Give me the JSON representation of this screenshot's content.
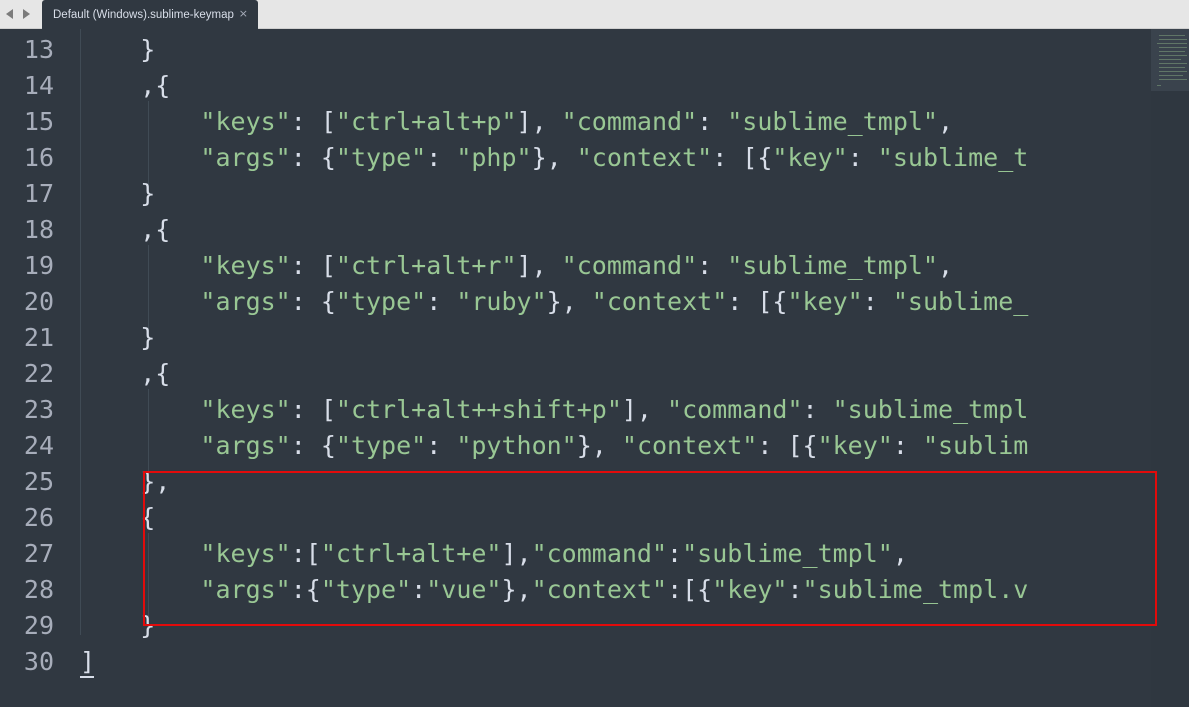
{
  "tab": {
    "title": "Default (Windows).sublime-keymap",
    "close_glyph": "×"
  },
  "nav": {
    "back_icon": "chevron-left-icon",
    "forward_icon": "chevron-right-icon"
  },
  "colors": {
    "background": "#303841",
    "string": "#99c794",
    "punctuation": "#d8dee9",
    "line_number": "#a7adba",
    "highlight_box": "#e20b0b"
  },
  "editor": {
    "lines": [
      {
        "number": "13",
        "indent": "    ",
        "tokens": [
          {
            "t": "}",
            "k": "p"
          }
        ]
      },
      {
        "number": "14",
        "indent": "    ",
        "tokens": [
          {
            "t": ",{",
            "k": "p"
          }
        ]
      },
      {
        "number": "15",
        "indent": "        ",
        "tokens": [
          {
            "t": "\"keys\"",
            "k": "s"
          },
          {
            "t": ": [",
            "k": "p"
          },
          {
            "t": "\"ctrl+alt+p\"",
            "k": "s"
          },
          {
            "t": "], ",
            "k": "p"
          },
          {
            "t": "\"command\"",
            "k": "s"
          },
          {
            "t": ": ",
            "k": "p"
          },
          {
            "t": "\"sublime_tmpl\"",
            "k": "s"
          },
          {
            "t": ",",
            "k": "p"
          }
        ]
      },
      {
        "number": "16",
        "indent": "        ",
        "tokens": [
          {
            "t": "\"args\"",
            "k": "s"
          },
          {
            "t": ": {",
            "k": "p"
          },
          {
            "t": "\"type\"",
            "k": "s"
          },
          {
            "t": ": ",
            "k": "p"
          },
          {
            "t": "\"php\"",
            "k": "s"
          },
          {
            "t": "}, ",
            "k": "p"
          },
          {
            "t": "\"context\"",
            "k": "s"
          },
          {
            "t": ": [{",
            "k": "p"
          },
          {
            "t": "\"key\"",
            "k": "s"
          },
          {
            "t": ": ",
            "k": "p"
          },
          {
            "t": "\"sublime_t",
            "k": "s"
          }
        ]
      },
      {
        "number": "17",
        "indent": "    ",
        "tokens": [
          {
            "t": "}",
            "k": "p"
          }
        ]
      },
      {
        "number": "18",
        "indent": "    ",
        "tokens": [
          {
            "t": ",{",
            "k": "p"
          }
        ]
      },
      {
        "number": "19",
        "indent": "        ",
        "tokens": [
          {
            "t": "\"keys\"",
            "k": "s"
          },
          {
            "t": ": [",
            "k": "p"
          },
          {
            "t": "\"ctrl+alt+r\"",
            "k": "s"
          },
          {
            "t": "], ",
            "k": "p"
          },
          {
            "t": "\"command\"",
            "k": "s"
          },
          {
            "t": ": ",
            "k": "p"
          },
          {
            "t": "\"sublime_tmpl\"",
            "k": "s"
          },
          {
            "t": ",",
            "k": "p"
          }
        ]
      },
      {
        "number": "20",
        "indent": "        ",
        "tokens": [
          {
            "t": "\"args\"",
            "k": "s"
          },
          {
            "t": ": {",
            "k": "p"
          },
          {
            "t": "\"type\"",
            "k": "s"
          },
          {
            "t": ": ",
            "k": "p"
          },
          {
            "t": "\"ruby\"",
            "k": "s"
          },
          {
            "t": "}, ",
            "k": "p"
          },
          {
            "t": "\"context\"",
            "k": "s"
          },
          {
            "t": ": [{",
            "k": "p"
          },
          {
            "t": "\"key\"",
            "k": "s"
          },
          {
            "t": ": ",
            "k": "p"
          },
          {
            "t": "\"sublime_",
            "k": "s"
          }
        ]
      },
      {
        "number": "21",
        "indent": "    ",
        "tokens": [
          {
            "t": "}",
            "k": "p"
          }
        ]
      },
      {
        "number": "22",
        "indent": "    ",
        "tokens": [
          {
            "t": ",{",
            "k": "p"
          }
        ]
      },
      {
        "number": "23",
        "indent": "        ",
        "tokens": [
          {
            "t": "\"keys\"",
            "k": "s"
          },
          {
            "t": ": [",
            "k": "p"
          },
          {
            "t": "\"ctrl+alt++shift+p\"",
            "k": "s"
          },
          {
            "t": "], ",
            "k": "p"
          },
          {
            "t": "\"command\"",
            "k": "s"
          },
          {
            "t": ": ",
            "k": "p"
          },
          {
            "t": "\"sublime_tmpl",
            "k": "s"
          }
        ]
      },
      {
        "number": "24",
        "indent": "        ",
        "tokens": [
          {
            "t": "\"args\"",
            "k": "s"
          },
          {
            "t": ": {",
            "k": "p"
          },
          {
            "t": "\"type\"",
            "k": "s"
          },
          {
            "t": ": ",
            "k": "p"
          },
          {
            "t": "\"python\"",
            "k": "s"
          },
          {
            "t": "}, ",
            "k": "p"
          },
          {
            "t": "\"context\"",
            "k": "s"
          },
          {
            "t": ": [{",
            "k": "p"
          },
          {
            "t": "\"key\"",
            "k": "s"
          },
          {
            "t": ": ",
            "k": "p"
          },
          {
            "t": "\"sublim",
            "k": "s"
          }
        ]
      },
      {
        "number": "25",
        "indent": "    ",
        "tokens": [
          {
            "t": "},",
            "k": "p"
          }
        ]
      },
      {
        "number": "26",
        "indent": "    ",
        "tokens": [
          {
            "t": "{",
            "k": "p"
          }
        ]
      },
      {
        "number": "27",
        "indent": "        ",
        "tokens": [
          {
            "t": "\"keys\"",
            "k": "s"
          },
          {
            "t": ":[",
            "k": "p"
          },
          {
            "t": "\"ctrl+alt+e\"",
            "k": "s"
          },
          {
            "t": "],",
            "k": "p"
          },
          {
            "t": "\"command\"",
            "k": "s"
          },
          {
            "t": ":",
            "k": "p"
          },
          {
            "t": "\"sublime_tmpl\"",
            "k": "s"
          },
          {
            "t": ",",
            "k": "p"
          }
        ]
      },
      {
        "number": "28",
        "indent": "        ",
        "tokens": [
          {
            "t": "\"args\"",
            "k": "s"
          },
          {
            "t": ":{",
            "k": "p"
          },
          {
            "t": "\"type\"",
            "k": "s"
          },
          {
            "t": ":",
            "k": "p"
          },
          {
            "t": "\"vue\"",
            "k": "s"
          },
          {
            "t": "},",
            "k": "p"
          },
          {
            "t": "\"context\"",
            "k": "s"
          },
          {
            "t": ":[{",
            "k": "p"
          },
          {
            "t": "\"key\"",
            "k": "s"
          },
          {
            "t": ":",
            "k": "p"
          },
          {
            "t": "\"sublime_tmpl.v",
            "k": "s"
          }
        ]
      },
      {
        "number": "29",
        "indent": "    ",
        "tokens": [
          {
            "t": "}",
            "k": "p"
          }
        ]
      },
      {
        "number": "30",
        "indent": "",
        "tokens": [
          {
            "t": "]",
            "k": "p"
          }
        ]
      }
    ]
  }
}
